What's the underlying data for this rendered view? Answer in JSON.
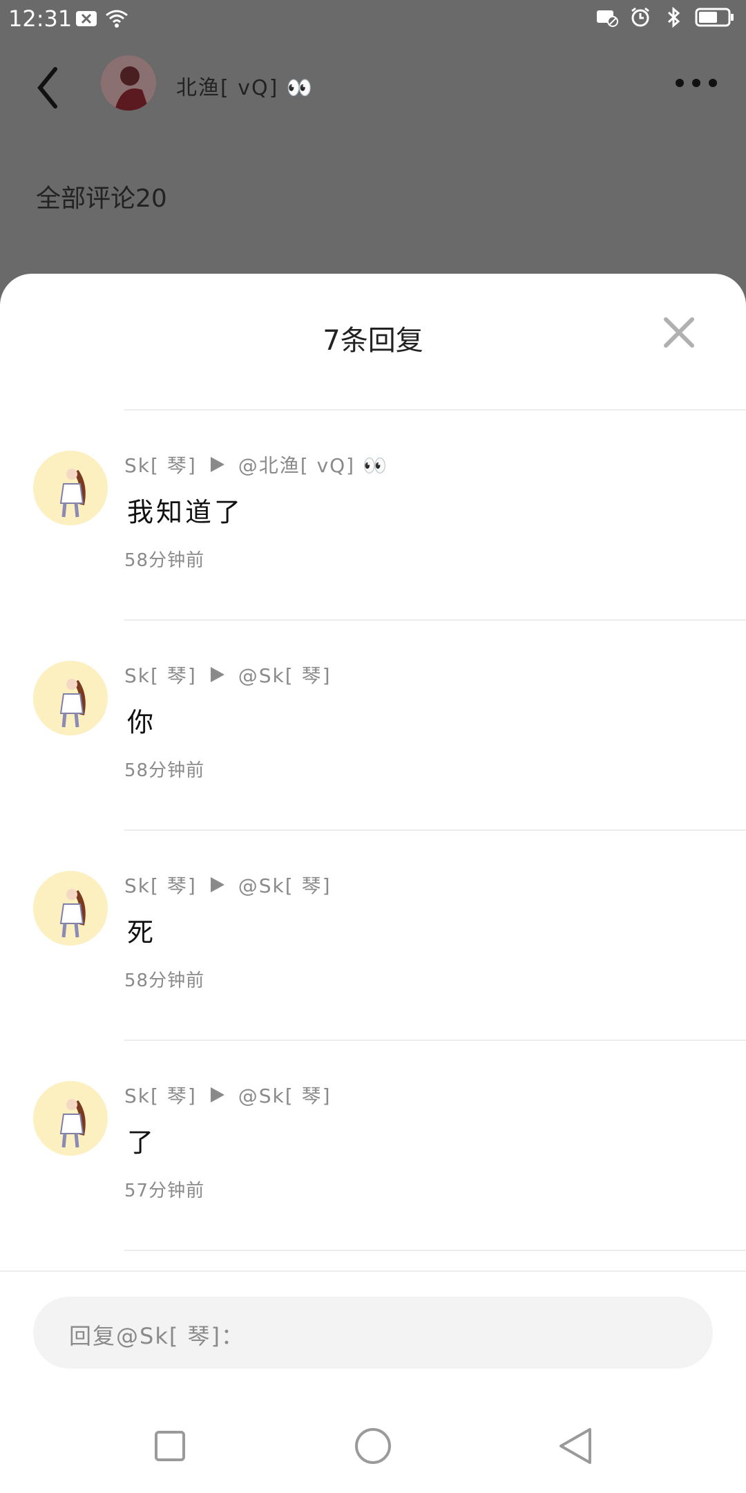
{
  "status_bar": {
    "time": "12:31"
  },
  "background_page": {
    "title": "北渔[ vQ] 👀",
    "all_comments_label": "全部评论20"
  },
  "sheet": {
    "title": "7条回复",
    "replies": [
      {
        "author": "Sk[ 琴]",
        "target": "@北渔[ vQ] 👀",
        "content": "我知道了",
        "time": "58分钟前"
      },
      {
        "author": "Sk[ 琴]",
        "target": "@Sk[ 琴]",
        "content": "你",
        "time": "58分钟前"
      },
      {
        "author": "Sk[ 琴]",
        "target": "@Sk[ 琴]",
        "content": "死",
        "time": "58分钟前"
      },
      {
        "author": "Sk[ 琴]",
        "target": "@Sk[ 琴]",
        "content": "了",
        "time": "57分钟前"
      }
    ],
    "reply_input_placeholder": "回复@Sk[ 琴]："
  },
  "colors": {
    "overlay": "#6a6a6a",
    "sheet_bg": "#ffffff",
    "meta_text": "#8a8a8a",
    "avatar_bg": "#fcefc0"
  }
}
